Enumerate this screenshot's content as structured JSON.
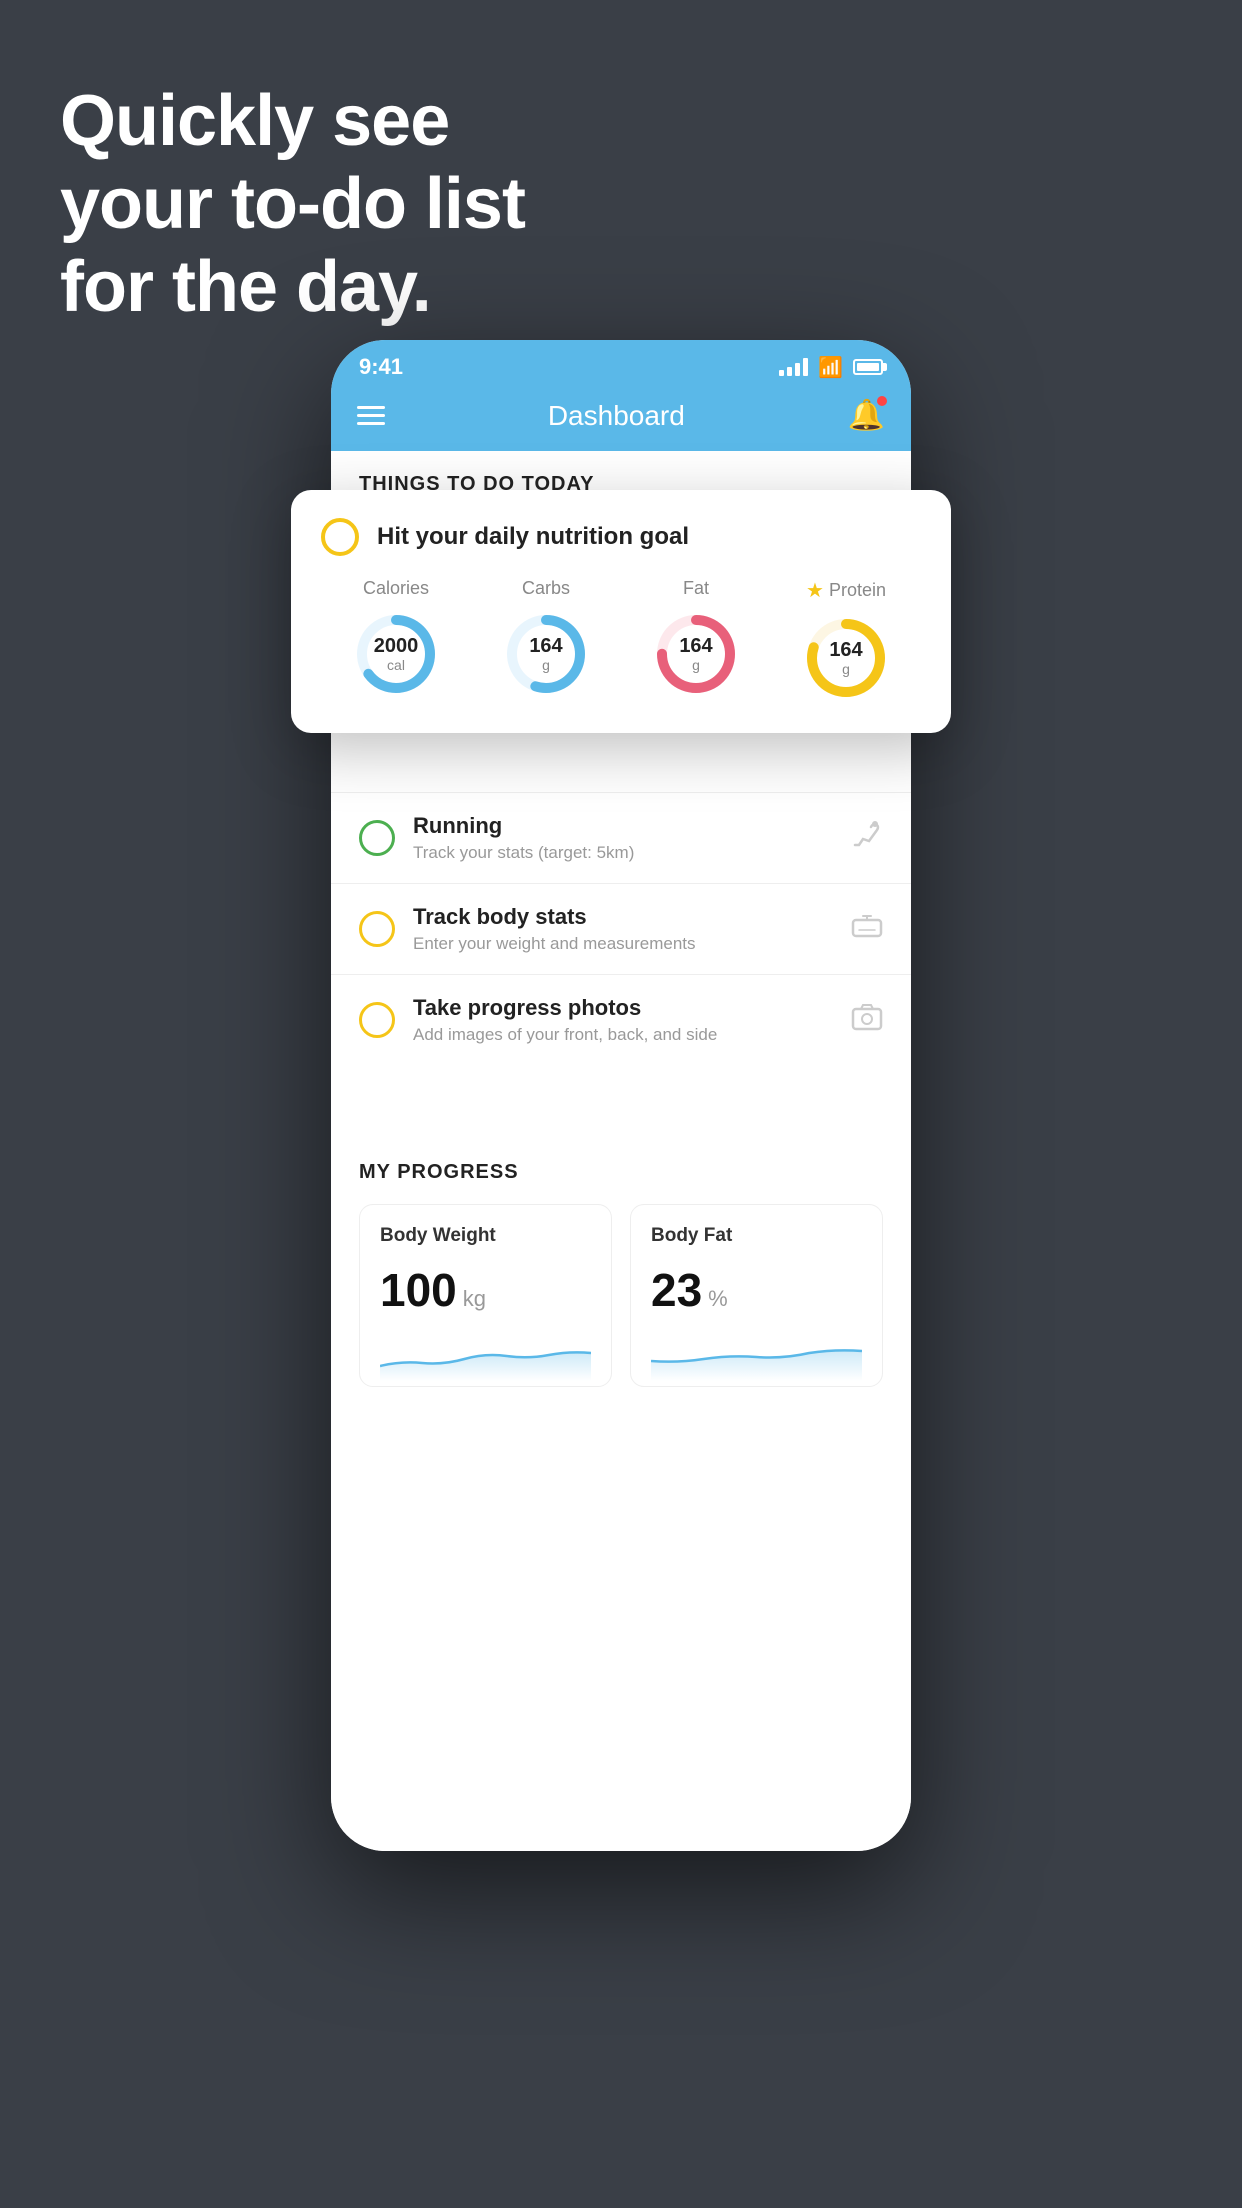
{
  "background_color": "#3a3f47",
  "hero": {
    "line1": "Quickly see",
    "line2": "your to-do list",
    "line3": "for the day."
  },
  "phone": {
    "status_bar": {
      "time": "9:41"
    },
    "nav": {
      "title": "Dashboard"
    },
    "things_section": {
      "header": "THINGS TO DO TODAY"
    },
    "nutrition_card": {
      "title": "Hit your daily nutrition goal",
      "macros": [
        {
          "label": "Calories",
          "value": "2000",
          "unit": "cal",
          "color": "#5ab8e8",
          "percent": 65
        },
        {
          "label": "Carbs",
          "value": "164",
          "unit": "g",
          "color": "#5ab8e8",
          "percent": 55
        },
        {
          "label": "Fat",
          "value": "164",
          "unit": "g",
          "color": "#e8607a",
          "percent": 75
        },
        {
          "label": "Protein",
          "value": "164",
          "unit": "g",
          "color": "#f5c518",
          "percent": 80,
          "starred": true
        }
      ]
    },
    "todo_items": [
      {
        "title": "Running",
        "subtitle": "Track your stats (target: 5km)",
        "circle_color": "green",
        "icon": "👟"
      },
      {
        "title": "Track body stats",
        "subtitle": "Enter your weight and measurements",
        "circle_color": "yellow",
        "icon": "⚖️"
      },
      {
        "title": "Take progress photos",
        "subtitle": "Add images of your front, back, and side",
        "circle_color": "yellow",
        "icon": "🪪"
      }
    ],
    "progress": {
      "header": "MY PROGRESS",
      "cards": [
        {
          "label": "Body Weight",
          "value": "100",
          "unit": "kg"
        },
        {
          "label": "Body Fat",
          "value": "23",
          "unit": "%"
        }
      ]
    }
  }
}
